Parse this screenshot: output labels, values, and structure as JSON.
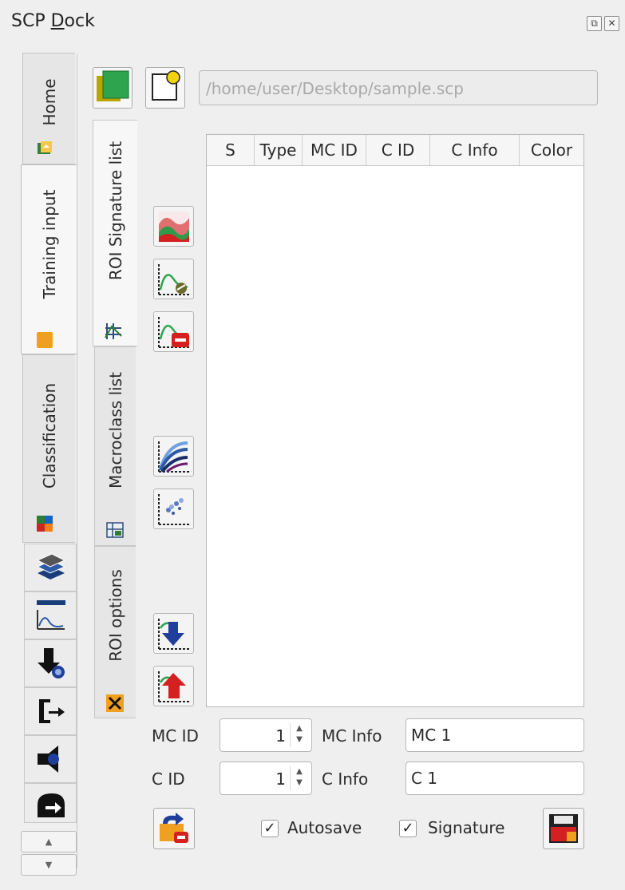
{
  "window": {
    "title_prefix": "SCP ",
    "title_mnemonic": "D",
    "title_rest": "ock",
    "float_icon": "float-icon",
    "close_icon": "close-icon"
  },
  "main_tabs": [
    {
      "label": "Home",
      "icon": "home-icon"
    },
    {
      "label": "Training input",
      "icon": "training-input-icon",
      "active": true
    },
    {
      "label": "Classification",
      "icon": "classification-icon"
    }
  ],
  "tool_tabs": [
    {
      "icon": "band-set-icon"
    },
    {
      "icon": "spectral-plot-icon"
    },
    {
      "icon": "download-icon"
    },
    {
      "icon": "preprocessing-icon"
    },
    {
      "icon": "postprocessing-icon"
    },
    {
      "icon": "band-calc-icon"
    }
  ],
  "training": {
    "path_placeholder": "/home/user/Desktop/sample.scp",
    "new_button_icon": "new-training-input-icon",
    "open_button_icon": "open-training-input-icon"
  },
  "sub_tabs": [
    {
      "label": "ROI Signature list",
      "icon": "roi-signature-icon",
      "active": true
    },
    {
      "label": "Macroclass list",
      "icon": "macroclass-icon"
    },
    {
      "label": "ROI options",
      "icon": "roi-options-icon"
    }
  ],
  "table": {
    "columns": [
      "S",
      "Type",
      "MC ID",
      "C ID",
      "C Info",
      "Color"
    ],
    "rows": []
  },
  "side_tools": [
    "merge-signatures-icon",
    "calculate-signatures-icon",
    "delete-signatures-icon",
    "spectral-signature-plot-icon",
    "scatter-plot-icon",
    "import-signatures-icon",
    "export-signatures-icon"
  ],
  "form": {
    "mc_id_label": "MC ID",
    "mc_id_value": "1",
    "mc_info_label": "MC Info",
    "mc_info_value": "MC 1",
    "c_id_label": "C ID",
    "c_id_value": "1",
    "c_info_label": "C Info",
    "c_info_value": "C 1",
    "autosave_label": "Autosave",
    "autosave_checked": true,
    "signature_label": "Signature",
    "signature_checked": true,
    "undo_icon": "undo-save-icon",
    "save_icon": "save-roi-icon"
  },
  "colors": {
    "accent_green": "#2ea44f",
    "accent_orange": "#f0a020",
    "accent_red": "#d42020",
    "accent_blue": "#1f3f9a"
  }
}
